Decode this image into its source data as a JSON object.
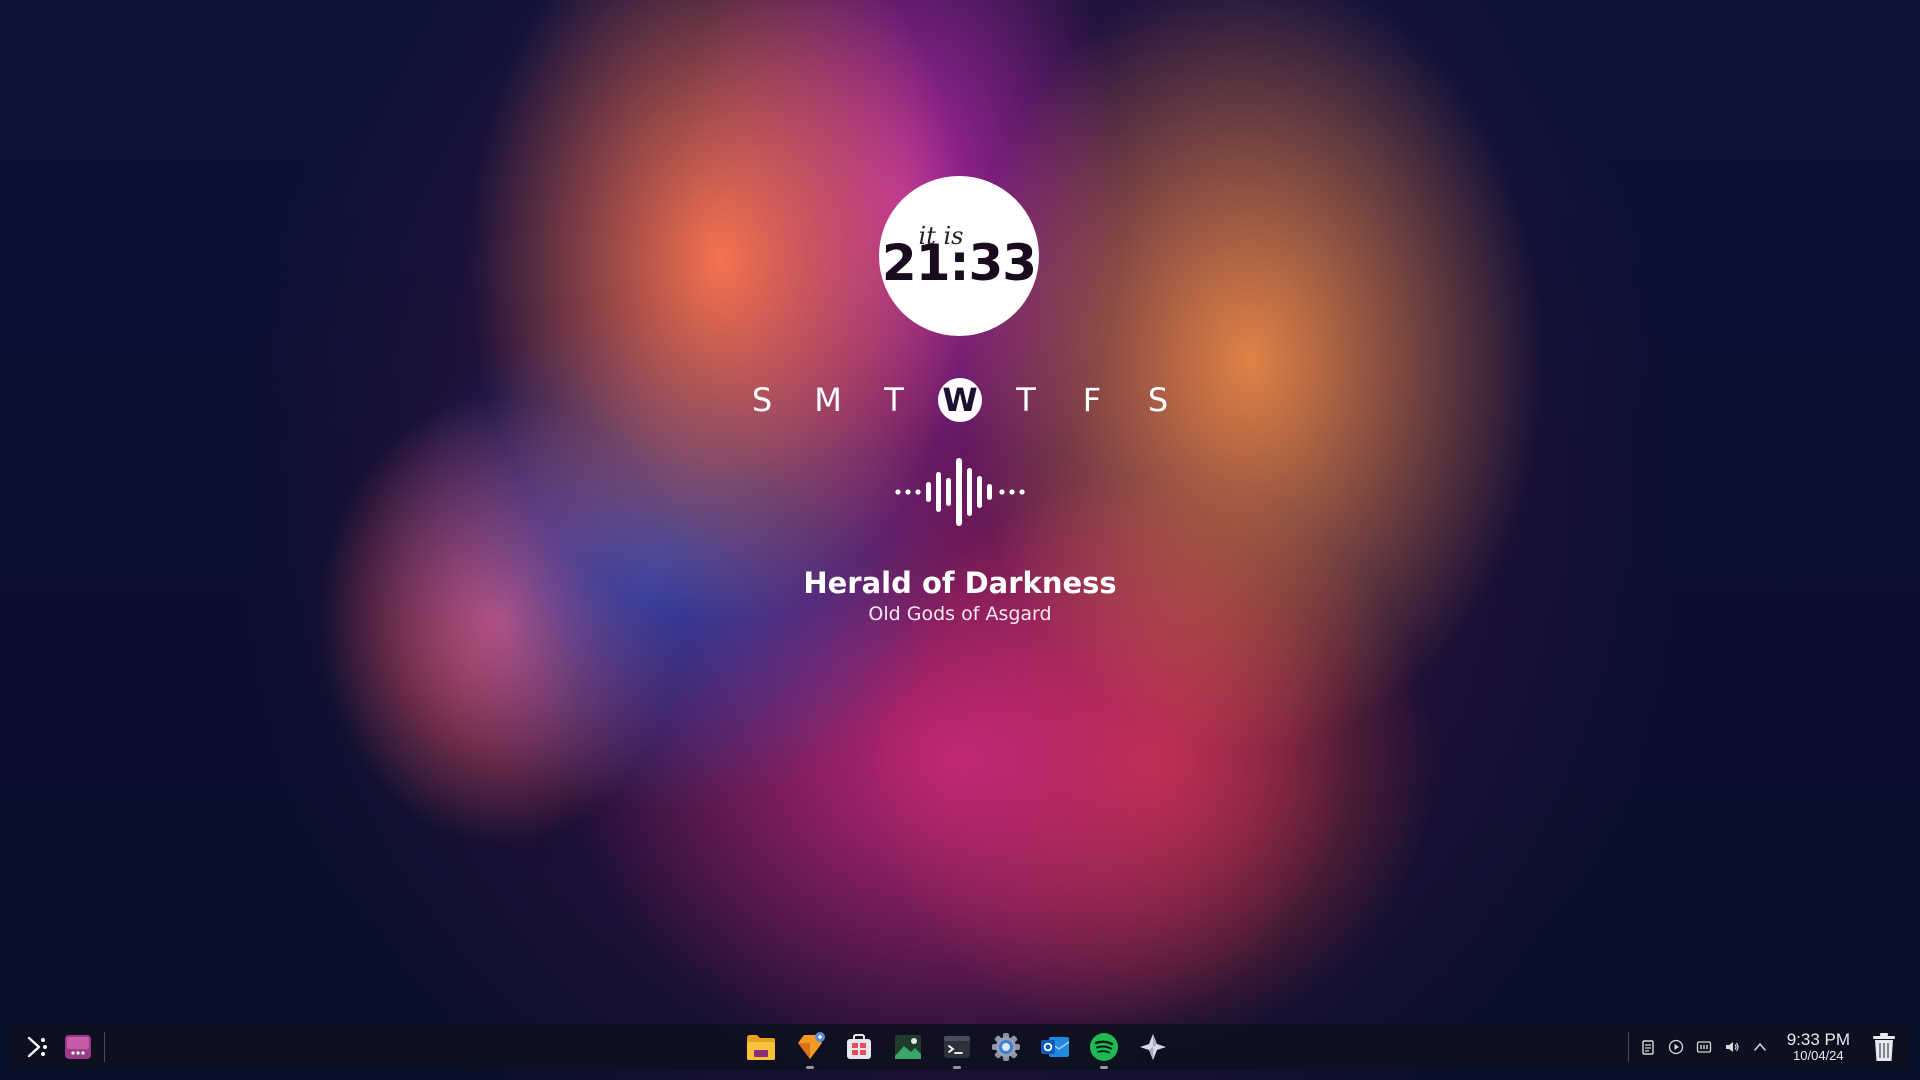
{
  "clock_widget": {
    "prefix": "it is",
    "time": "21:33"
  },
  "week_days": [
    {
      "label": "S",
      "active": false
    },
    {
      "label": "M",
      "active": false
    },
    {
      "label": "T",
      "active": false
    },
    {
      "label": "W",
      "active": true
    },
    {
      "label": "T",
      "active": false
    },
    {
      "label": "F",
      "active": false
    },
    {
      "label": "S",
      "active": false
    }
  ],
  "now_playing": {
    "title": "Herald of Darkness",
    "artist": "Old Gods of Asgard",
    "icon": "audio-waveform-icon"
  },
  "taskbar": {
    "left": [
      {
        "name": "app-launcher-icon"
      },
      {
        "name": "overview-icon"
      }
    ],
    "apps": [
      {
        "name": "file-manager-icon",
        "color": "#f5b324",
        "running": false
      },
      {
        "name": "discover-store-icon",
        "color": "#f7a531",
        "running": true
      },
      {
        "name": "software-center-icon",
        "color": "#e8e8ee",
        "running": false
      },
      {
        "name": "image-viewer-icon",
        "color": "#3aa66a",
        "running": false
      },
      {
        "name": "terminal-icon",
        "color": "#2d2f3a",
        "running": true
      },
      {
        "name": "system-settings-icon",
        "color": "#3d7fd6",
        "running": false
      },
      {
        "name": "outlook-mail-icon",
        "color": "#1a6fd1",
        "running": false
      },
      {
        "name": "spotify-icon",
        "color": "#1db954",
        "running": true
      },
      {
        "name": "krita-icon",
        "color": "#d9d9e6",
        "running": false
      }
    ],
    "tray": [
      {
        "name": "clipboard-icon",
        "glyph": "▤"
      },
      {
        "name": "media-player-icon",
        "glyph": "▶"
      },
      {
        "name": "battery-icon",
        "glyph": "▥"
      },
      {
        "name": "volume-icon",
        "glyph": "🔊"
      },
      {
        "name": "tray-expand-icon",
        "glyph": "⌃"
      }
    ],
    "clock": {
      "time": "9:33 PM",
      "date": "10/04/24"
    },
    "trash_icon": "trash-icon"
  }
}
